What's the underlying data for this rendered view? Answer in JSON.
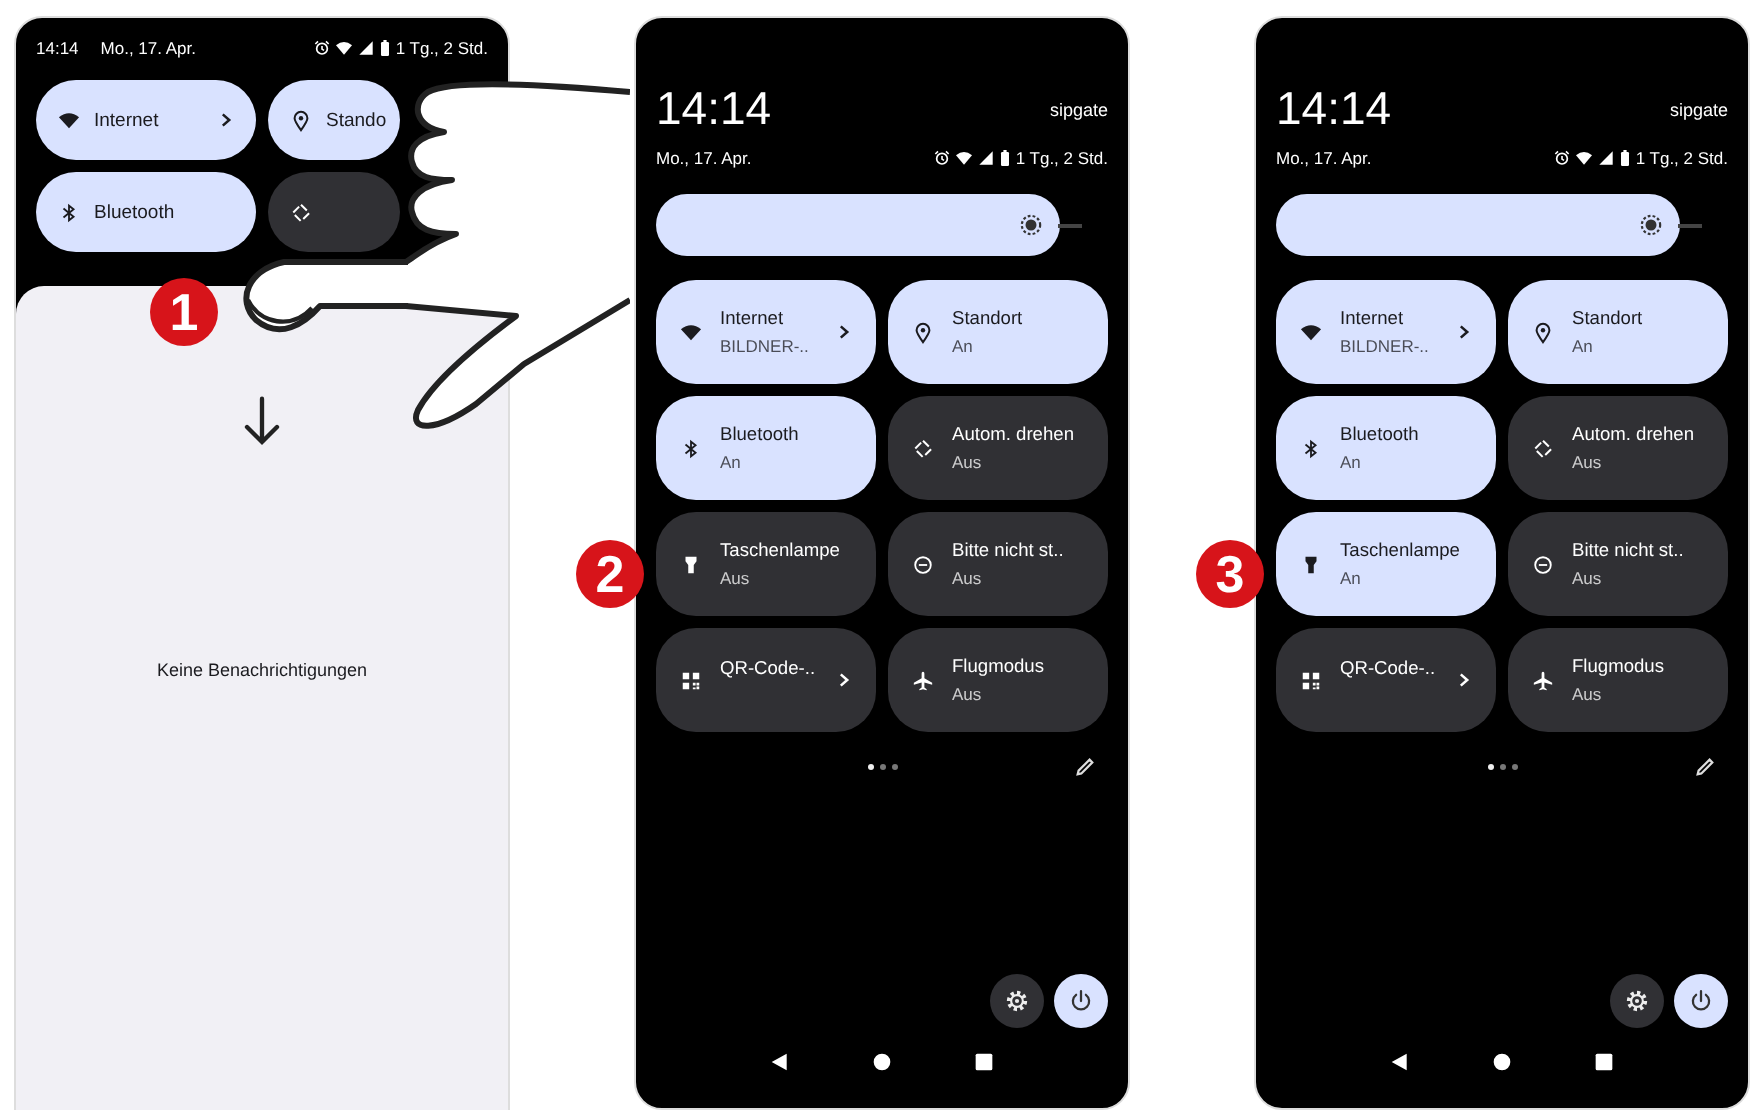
{
  "phones": [
    {
      "kind": "compact",
      "step": "1",
      "status": {
        "time": "14:14",
        "date": "Mo., 17. Apr.",
        "battery": "1 Tg., 2 Std."
      },
      "tiles": [
        {
          "kind": "wifi",
          "label": "Internet",
          "on": true,
          "chevron": true
        },
        {
          "kind": "location",
          "label": "Stando",
          "on": true,
          "chevron": false
        },
        {
          "kind": "bluetooth",
          "label": "Bluetooth",
          "on": true,
          "chevron": false
        },
        {
          "kind": "rotate",
          "on": false,
          "chevron": false
        }
      ],
      "notifications": "Keine Benachrichtigungen"
    },
    {
      "kind": "expanded",
      "step": "2",
      "clock": "14:14",
      "carrier": "sipgate",
      "status": {
        "date": "Mo., 17. Apr.",
        "battery": "1 Tg., 2 Std."
      },
      "brightness": {
        "level": 0.95
      },
      "tiles": [
        {
          "kind": "wifi",
          "label": "Internet",
          "sublabel": "BILDNER-..",
          "on": true,
          "chevron": true
        },
        {
          "kind": "location",
          "label": "Standort",
          "sublabel": "An",
          "on": true,
          "chevron": false
        },
        {
          "kind": "bluetooth",
          "label": "Bluetooth",
          "sublabel": "An",
          "on": true,
          "chevron": false
        },
        {
          "kind": "rotate",
          "label": "Autom. drehen",
          "sublabel": "Aus",
          "on": false,
          "chevron": false
        },
        {
          "kind": "flashlight",
          "label": "Taschenlampe",
          "sublabel": "Aus",
          "on": false,
          "chevron": false
        },
        {
          "kind": "dnd",
          "label": "Bitte nicht st..",
          "sublabel": "Aus",
          "on": false,
          "chevron": false
        },
        {
          "kind": "qr",
          "label": "QR-Code-..",
          "on": false,
          "chevron": true
        },
        {
          "kind": "airplane",
          "label": "Flugmodus",
          "sublabel": "Aus",
          "on": false,
          "chevron": false
        }
      ],
      "pages": [
        {
          "selected": true
        },
        {
          "selected": false
        },
        {
          "selected": false
        }
      ]
    },
    {
      "kind": "expanded",
      "step": "3",
      "clock": "14:14",
      "carrier": "sipgate",
      "status": {
        "date": "Mo., 17. Apr.",
        "battery": "1 Tg., 2 Std."
      },
      "brightness": {
        "level": 0.95
      },
      "tiles": [
        {
          "kind": "wifi",
          "label": "Internet",
          "sublabel": "BILDNER-..",
          "on": true,
          "chevron": true
        },
        {
          "kind": "location",
          "label": "Standort",
          "sublabel": "An",
          "on": true,
          "chevron": false
        },
        {
          "kind": "bluetooth",
          "label": "Bluetooth",
          "sublabel": "An",
          "on": true,
          "chevron": false
        },
        {
          "kind": "rotate",
          "label": "Autom. drehen",
          "sublabel": "Aus",
          "on": false,
          "chevron": false
        },
        {
          "kind": "flashlight",
          "label": "Taschenlampe",
          "sublabel": "An",
          "on": true,
          "chevron": false
        },
        {
          "kind": "dnd",
          "label": "Bitte nicht st..",
          "sublabel": "Aus",
          "on": false,
          "chevron": false
        },
        {
          "kind": "qr",
          "label": "QR-Code-..",
          "on": false,
          "chevron": true
        },
        {
          "kind": "airplane",
          "label": "Flugmodus",
          "sublabel": "Aus",
          "on": false,
          "chevron": false
        }
      ],
      "pages": [
        {
          "selected": true
        },
        {
          "selected": false
        },
        {
          "selected": false
        }
      ]
    }
  ]
}
